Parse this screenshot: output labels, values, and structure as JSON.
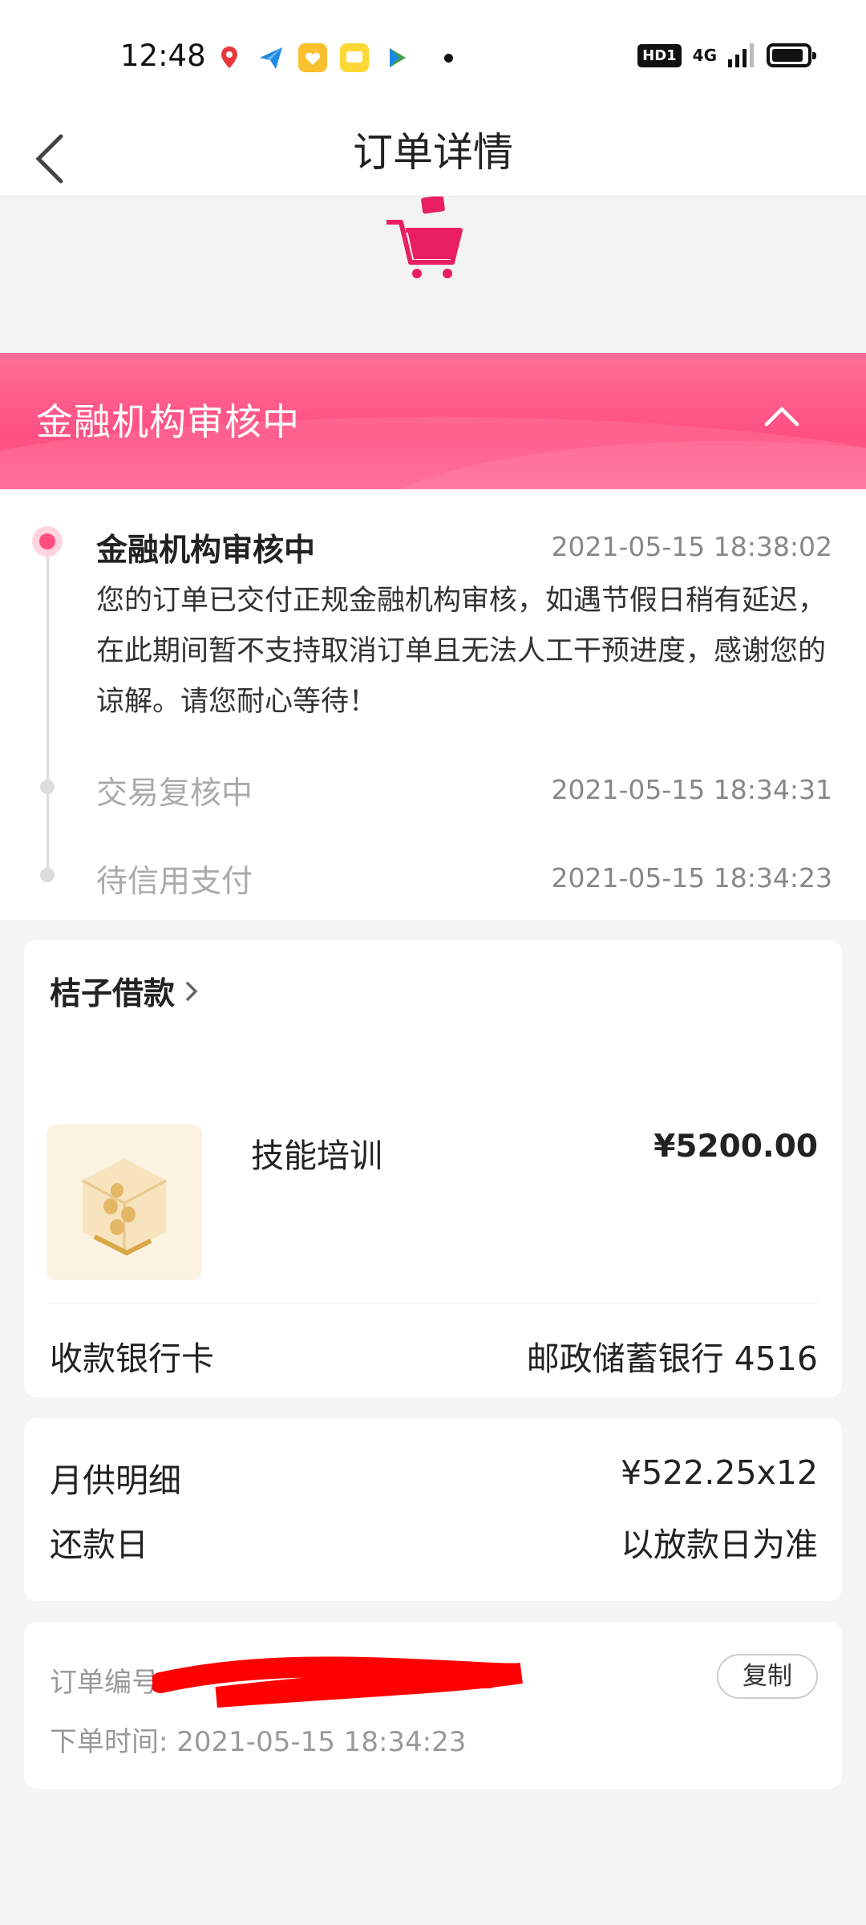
{
  "status_bar": {
    "time": "12:48",
    "network": "4G",
    "hd_badge": "HD1"
  },
  "nav": {
    "title": "订单详情",
    "back_icon": "chevron-left-icon"
  },
  "banner": {
    "title": "金融机构审核中",
    "toggle_icon": "chevron-up-icon",
    "color": "#ff4f82"
  },
  "timeline": [
    {
      "title": "金融机构审核中",
      "time": "2021-05-15 18:38:02",
      "desc": "您的订单已交付正规金融机构审核，如遇节假日稍有延迟，在此期间暂不支持取消订单且无法人工干预进度，感谢您的谅解。请您耐心等待！",
      "active": true
    },
    {
      "title": "交易复核中",
      "time": "2021-05-15 18:34:31",
      "active": false
    },
    {
      "title": "待信用支付",
      "time": "2021-05-15 18:34:23",
      "active": false
    }
  ],
  "product_card": {
    "merchant": "桔子借款",
    "product_name": "技能培训",
    "price": "¥5200.00",
    "bank_label": "收款银行卡",
    "bank_value": "邮政储蓄银行 4516"
  },
  "payment_card": {
    "monthly_label": "月供明细",
    "monthly_value": "¥522.25x12",
    "repay_label": "还款日",
    "repay_value": "以放款日为准"
  },
  "order_card": {
    "order_no_label": "订单编号",
    "copy_label": "复制",
    "order_time_label": "下单时间:",
    "order_time": "2021-05-15 18:34:23"
  }
}
